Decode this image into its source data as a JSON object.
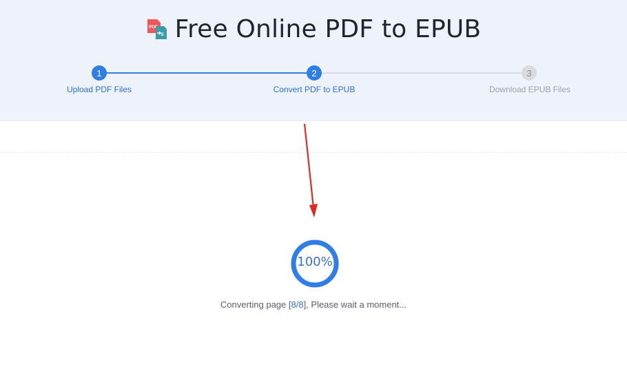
{
  "header": {
    "title": "Free Online PDF to EPUB",
    "logo_icon": "pdf-to-epub-icon"
  },
  "steps": [
    {
      "number": "1",
      "label": "Upload PDF Files",
      "state": "done"
    },
    {
      "number": "2",
      "label": "Convert PDF to EPUB",
      "state": "active"
    },
    {
      "number": "3",
      "label": "Download EPUB Files",
      "state": "pending"
    }
  ],
  "progress": {
    "percent_text": "100%",
    "fraction": 1.0
  },
  "status": {
    "prefix": "Converting page [",
    "count": "8/8",
    "suffix": "], Please wait a moment..."
  },
  "colors": {
    "accent": "#2f7ee8",
    "pending": "#d5d8de",
    "header_bg": "#eef3fb",
    "arrow": "#e02a22"
  }
}
